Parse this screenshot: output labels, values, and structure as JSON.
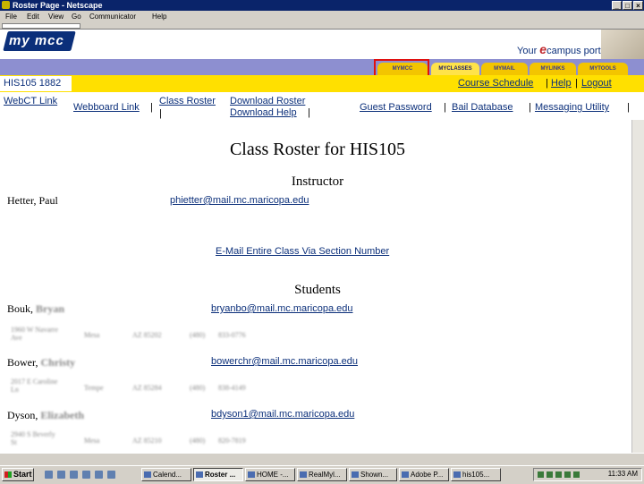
{
  "window": {
    "title": "Roster Page - Netscape"
  },
  "menu": [
    "File",
    "Edit",
    "View",
    "Go",
    "Communicator",
    "Help"
  ],
  "banner": {
    "logo": "my mcc",
    "portal_prefix": "Your ",
    "portal_e": "e",
    "portal_suffix": "campus portal."
  },
  "tabs": [
    "MYMCC",
    "MYCLASSES",
    "MYMAIL",
    "MYLINKS",
    "MYTOOLS"
  ],
  "course": {
    "code": "HIS105 1882"
  },
  "toplinks": [
    "Course Schedule",
    "Help",
    "Logout"
  ],
  "links": {
    "webct": "WebCT Link",
    "webboard": "Webboard Link",
    "class_roster": "Class Roster",
    "download_roster": "Download Roster",
    "download_help": "Download Help",
    "guest_password": "Guest Password",
    "bail_database": "Bail Database",
    "messaging_utility": "Messaging Utility"
  },
  "page": {
    "title": "Class Roster for HIS105",
    "instructor_heading": "Instructor",
    "instructor_name": "Hetter, Paul",
    "instructor_email": "phietter@mail.mc.maricopa.edu",
    "email_all": "E-Mail Entire Class Via Section Number",
    "students_heading": "Students"
  },
  "students": [
    {
      "last": "Bouk,",
      "first": "Bryan",
      "email": "bryanbo@mail.mc.maricopa.edu",
      "street1": "1960 W Navarre",
      "street2": "Ave",
      "city": "Mesa",
      "statezip": "AZ 85202",
      "area": "(480)",
      "phone": "833-0776"
    },
    {
      "last": "Bower,",
      "first": "Christy",
      "email": "bowerchr@mail.mc.maricopa.edu",
      "street1": "2017 E Caroline",
      "street2": "Ln",
      "city": "Tempe",
      "statezip": "AZ 85284",
      "area": "(480)",
      "phone": "838-4149"
    },
    {
      "last": "Dyson,",
      "first": "Elizabeth",
      "email": "bdyson1@mail.mc.maricopa.edu",
      "street1": "2940 S Beverly",
      "street2": "St",
      "city": "Mesa",
      "statezip": "AZ 85210",
      "area": "(480)",
      "phone": "820-7819"
    }
  ],
  "taskbar": {
    "start": "Start",
    "tasks": [
      "Calend...",
      "Roster ...",
      "HOME -...",
      "RealMyl...",
      "Shown...",
      "Adobe P...",
      "his105..."
    ],
    "clock": "11:33 AM"
  }
}
